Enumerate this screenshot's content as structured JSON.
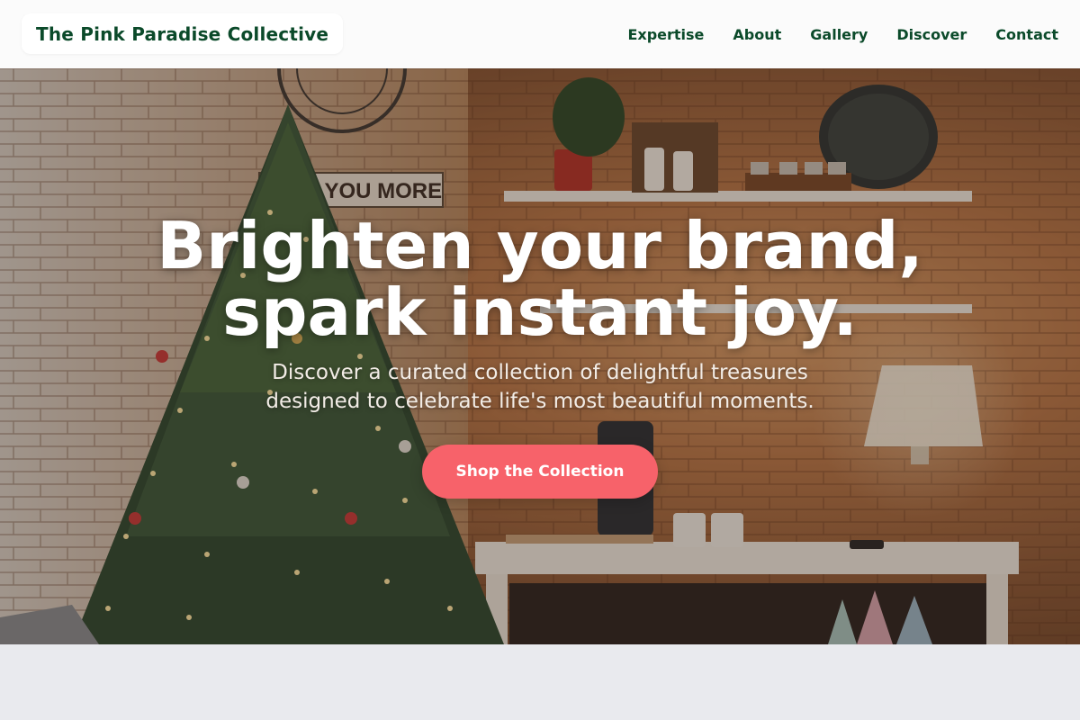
{
  "site": {
    "brand": "The Pink Paradise Collective"
  },
  "nav": {
    "items": [
      {
        "label": "Expertise"
      },
      {
        "label": "About"
      },
      {
        "label": "Gallery"
      },
      {
        "label": "Discover"
      },
      {
        "label": "Contact"
      }
    ]
  },
  "hero": {
    "title_line1": "Brighten your brand,",
    "title_line2": "spark instant joy.",
    "subtitle": "Discover a curated collection of delightful treasures designed to celebrate life's most beautiful moments.",
    "cta_label": "Shop the Collection",
    "sign_text": "LOVE YOU MORE",
    "image_description": "festive-shop-interior-christmas-tree-brick-wall"
  },
  "colors": {
    "brand_green": "#0b4a2a",
    "cta_coral": "#f7626a",
    "header_bg": "#fbfbfb",
    "footer_band": "#e9eaee"
  }
}
